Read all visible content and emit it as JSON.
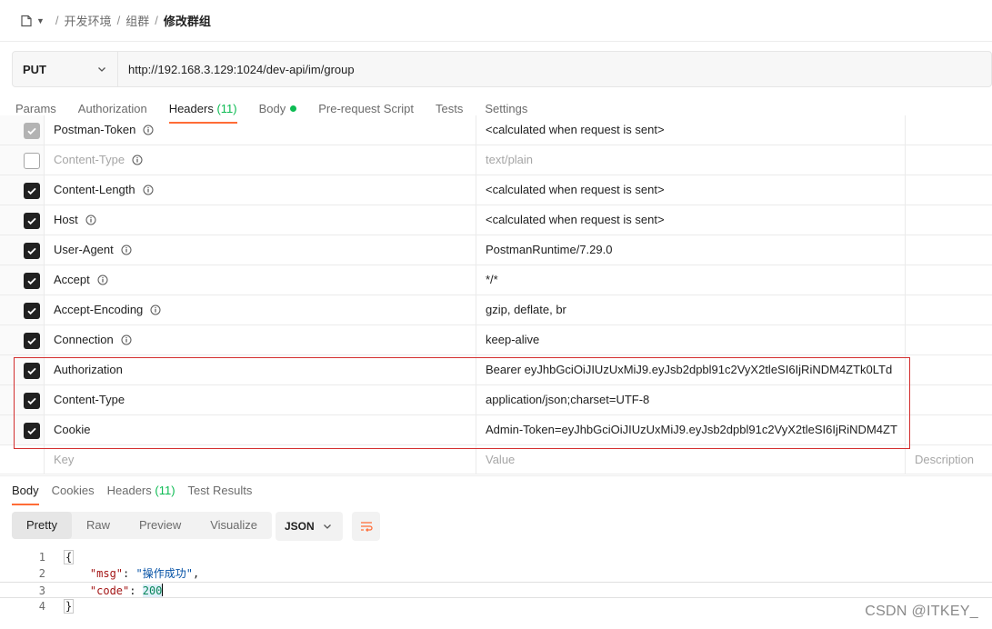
{
  "breadcrumb": {
    "items": [
      "开发环境",
      "组群"
    ],
    "current": "修改群组",
    "separator": "/"
  },
  "request": {
    "method": "PUT",
    "url": "http://192.168.3.129:1024/dev-api/im/group"
  },
  "request_tabs": {
    "params": "Params",
    "authorization": "Authorization",
    "headers": "Headers",
    "headers_count": "(11)",
    "body": "Body",
    "pre_request": "Pre-request Script",
    "tests": "Tests",
    "settings": "Settings"
  },
  "headers": [
    {
      "key": "Postman-Token",
      "value": "<calculated when request is sent>",
      "state": "disabled-checked",
      "info": true
    },
    {
      "key": "Content-Type",
      "value": "text/plain",
      "state": "unchecked",
      "info": true
    },
    {
      "key": "Content-Length",
      "value": "<calculated when request is sent>",
      "state": "checked",
      "info": true
    },
    {
      "key": "Host",
      "value": "<calculated when request is sent>",
      "state": "checked",
      "info": true
    },
    {
      "key": "User-Agent",
      "value": "PostmanRuntime/7.29.0",
      "state": "checked",
      "info": true
    },
    {
      "key": "Accept",
      "value": "*/*",
      "state": "checked",
      "info": true
    },
    {
      "key": "Accept-Encoding",
      "value": "gzip, deflate, br",
      "state": "checked",
      "info": true
    },
    {
      "key": "Connection",
      "value": "keep-alive",
      "state": "checked",
      "info": true
    },
    {
      "key": "Authorization",
      "value": "Bearer eyJhbGciOiJIUzUxMiJ9.eyJsb2dpbl91c2VyX2tleSI6IjRiNDM4ZTk0LTd",
      "state": "checked",
      "info": false
    },
    {
      "key": "Content-Type",
      "value": "application/json;charset=UTF-8",
      "state": "checked",
      "info": false
    },
    {
      "key": "Cookie",
      "value": "Admin-Token=eyJhbGciOiJIUzUxMiJ9.eyJsb2dpbl91c2VyX2tleSI6IjRiNDM4ZT",
      "state": "checked",
      "info": false
    }
  ],
  "new_row": {
    "key": "Key",
    "value": "Value",
    "description": "Description"
  },
  "response_tabs": {
    "body": "Body",
    "cookies": "Cookies",
    "headers": "Headers",
    "headers_count": "(11)",
    "test_results": "Test Results"
  },
  "view_modes": {
    "pretty": "Pretty",
    "raw": "Raw",
    "preview": "Preview",
    "visualize": "Visualize"
  },
  "format": "JSON",
  "response_code": {
    "line_numbers": [
      "1",
      "2",
      "3",
      "4"
    ],
    "open_brace": "{",
    "close_brace": "}",
    "msg_key": "\"msg\"",
    "msg_value": "\"操作成功\"",
    "code_key": "\"code\"",
    "code_value": "200"
  },
  "watermark": "CSDN @ITKEY_",
  "colors": {
    "accent": "#ff6c37",
    "success": "#0cbb52",
    "highlight": "#d32f2f"
  }
}
